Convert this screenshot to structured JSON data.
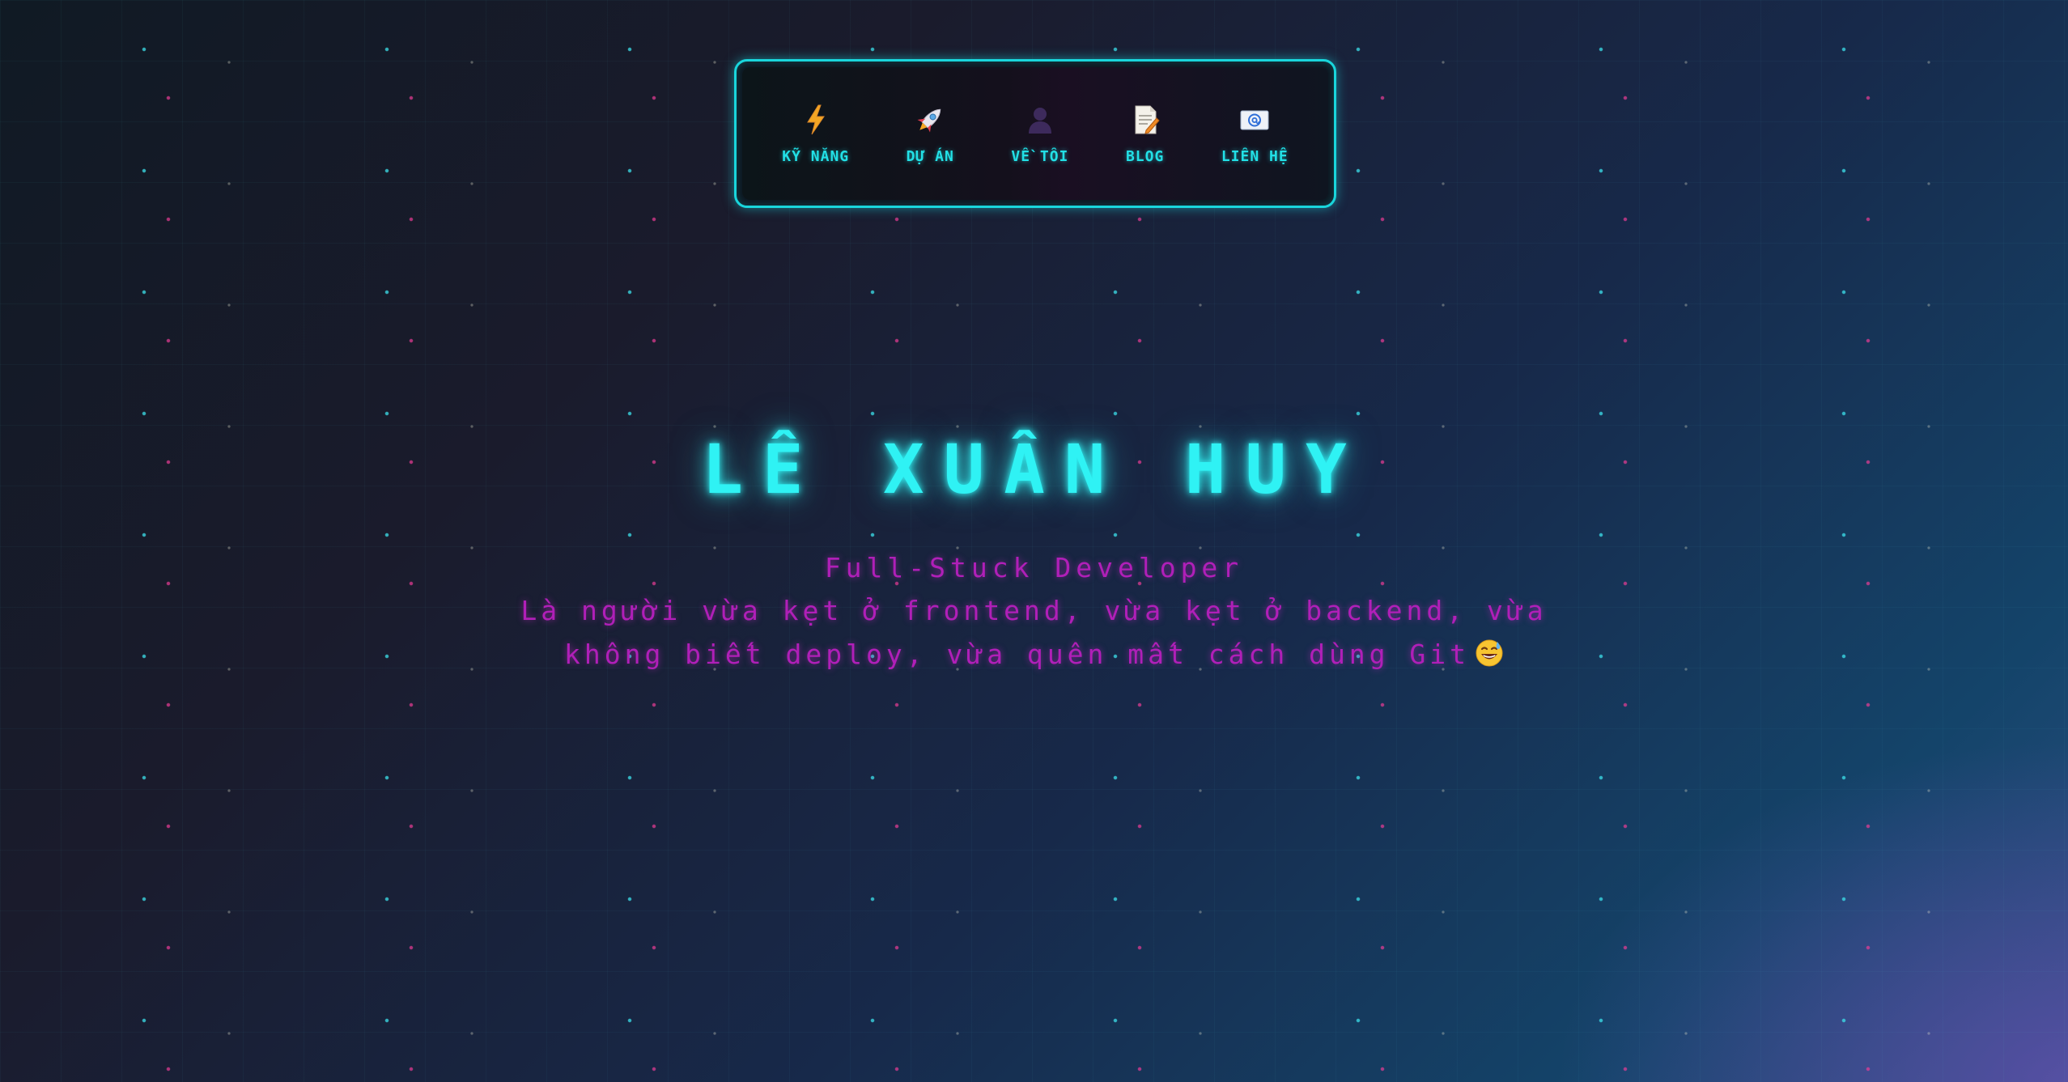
{
  "nav": {
    "items": [
      {
        "label": "KỸ NĂNG",
        "icon": "lightning-icon"
      },
      {
        "label": "DỰ ÁN",
        "icon": "rocket-icon"
      },
      {
        "label": "VỀ TÔI",
        "icon": "person-icon"
      },
      {
        "label": "BLOG",
        "icon": "document-icon"
      },
      {
        "label": "LIÊN HỆ",
        "icon": "email-icon"
      }
    ]
  },
  "hero": {
    "name": "LÊ XUÂN HUY",
    "subtitle": "Full-Stuck Developer",
    "description": "Là người vừa kẹt ở frontend, vừa kẹt ở backend, vừa không biết deploy, vừa quên mất cách dùng Git",
    "emoji": "grinning-sweat-emoji"
  },
  "colors": {
    "accent_cyan": "#2ff2f4",
    "accent_magenta": "#b01fb8",
    "background_dark": "#101a24",
    "nav_border": "#19d6dc"
  }
}
